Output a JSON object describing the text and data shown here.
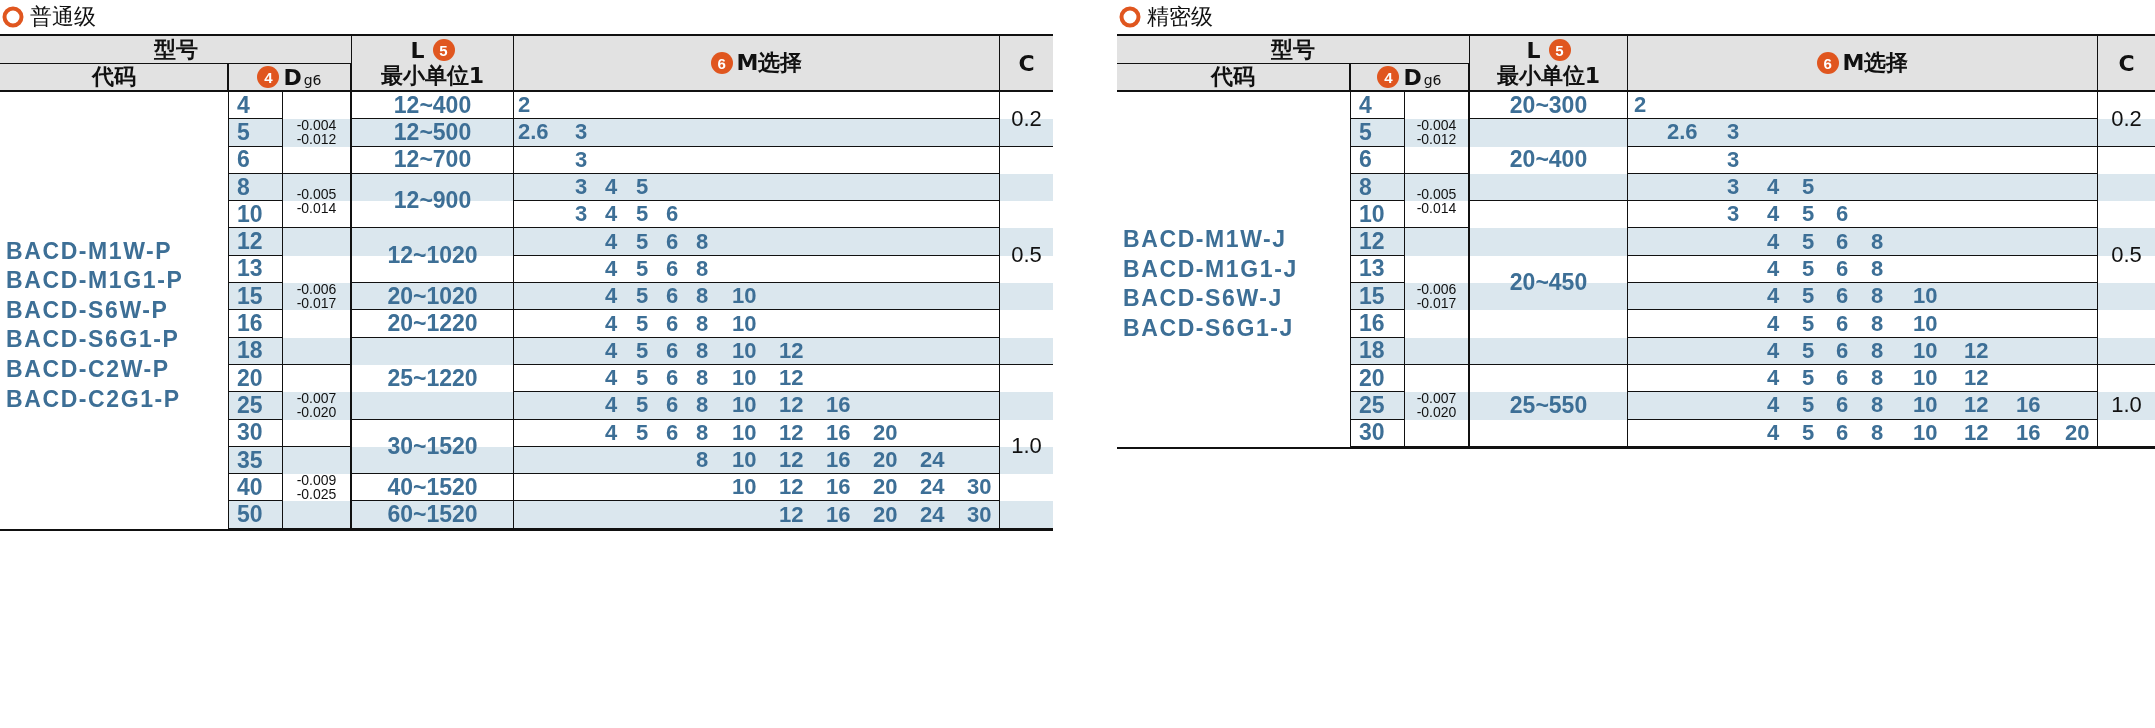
{
  "sections": [
    {
      "title": "普通级",
      "table": {
        "header": {
          "model": "型号",
          "code": "代码",
          "d_badge": "4",
          "d": "D$_{g6}$",
          "l": "L",
          "l_badge": "5",
          "l_note": "最小单位1",
          "m_badge": "6",
          "m": "M选择",
          "c": "C"
        },
        "codes": [
          "BACD-M1W-P",
          "BACD-M1G1-P",
          "BACD-S6W-P",
          "BACD-S6G1-P",
          "BACD-C2W-P",
          "BACD-C2G1-P"
        ],
        "rows": [
          {
            "d": "4",
            "tolerance": {
              "upper": "-0.004",
              "lower": "-0.012"
            },
            "length": "12~400",
            "m": [
              {
                "kind": "number",
                "text": "2"
              }
            ],
            "chamfer": "0.2"
          },
          {
            "d": "5",
            "length": "12~500",
            "m": [
              {
                "kind": "number",
                "text": "2.6"
              },
              {
                "kind": "number",
                "text": "3"
              }
            ]
          },
          {
            "d": "6",
            "length": "12~700",
            "m": [
              {
                "kind": "blank"
              },
              {
                "kind": "number",
                "text": "3"
              }
            ],
            "chamfer": "0.5"
          },
          {
            "d": "8",
            "tolerance": {
              "upper": "-0.005",
              "lower": "-0.014"
            },
            "length": "12~900",
            "m": [
              {
                "kind": "blank"
              },
              {
                "kind": "number",
                "text": "3"
              },
              {
                "kind": "number",
                "text": "4"
              },
              {
                "kind": "number",
                "text": "5"
              }
            ]
          },
          {
            "d": "10",
            "m": [
              {
                "kind": "blank"
              },
              {
                "kind": "number",
                "text": "3"
              },
              {
                "kind": "number",
                "text": "4"
              },
              {
                "kind": "number",
                "text": "5"
              },
              {
                "kind": "number",
                "text": "6"
              }
            ]
          },
          {
            "d": "12",
            "tolerance": {
              "upper": "-0.006",
              "lower": "-0.017"
            },
            "length": "12~1020",
            "m": [
              {
                "kind": "blank"
              },
              {
                "kind": "blank"
              },
              {
                "kind": "number",
                "text": "4"
              },
              {
                "kind": "number",
                "text": "5"
              },
              {
                "kind": "number",
                "text": "6"
              },
              {
                "kind": "number",
                "text": "8"
              }
            ]
          },
          {
            "d": "13",
            "m": [
              {
                "kind": "blank"
              },
              {
                "kind": "blank"
              },
              {
                "kind": "number",
                "text": "4"
              },
              {
                "kind": "number",
                "text": "5"
              },
              {
                "kind": "number",
                "text": "6"
              },
              {
                "kind": "number",
                "text": "8"
              }
            ]
          },
          {
            "d": "15",
            "length": "20~1020",
            "m": [
              {
                "kind": "blank"
              },
              {
                "kind": "blank"
              },
              {
                "kind": "number",
                "text": "4"
              },
              {
                "kind": "number",
                "text": "5"
              },
              {
                "kind": "number",
                "text": "6"
              },
              {
                "kind": "number",
                "text": "8"
              },
              {
                "kind": "number",
                "text": "10"
              }
            ]
          },
          {
            "d": "16",
            "length": "20~1220",
            "m": [
              {
                "kind": "blank"
              },
              {
                "kind": "blank"
              },
              {
                "kind": "number",
                "text": "4"
              },
              {
                "kind": "number",
                "text": "5"
              },
              {
                "kind": "number",
                "text": "6"
              },
              {
                "kind": "number",
                "text": "8"
              },
              {
                "kind": "number",
                "text": "10"
              }
            ]
          },
          {
            "d": "18",
            "length": "25~1220",
            "m": [
              {
                "kind": "blank"
              },
              {
                "kind": "blank"
              },
              {
                "kind": "number",
                "text": "4"
              },
              {
                "kind": "number",
                "text": "5"
              },
              {
                "kind": "number",
                "text": "6"
              },
              {
                "kind": "number",
                "text": "8"
              },
              {
                "kind": "number",
                "text": "10"
              },
              {
                "kind": "number",
                "text": "12"
              }
            ]
          },
          {
            "d": "20",
            "tolerance": {
              "upper": "-0.007",
              "lower": "-0.020"
            },
            "m": [
              {
                "kind": "blank"
              },
              {
                "kind": "blank"
              },
              {
                "kind": "number",
                "text": "4"
              },
              {
                "kind": "number",
                "text": "5"
              },
              {
                "kind": "number",
                "text": "6"
              },
              {
                "kind": "number",
                "text": "8"
              },
              {
                "kind": "number",
                "text": "10"
              },
              {
                "kind": "number",
                "text": "12"
              }
            ],
            "chamfer": "1.0"
          },
          {
            "d": "25",
            "m": [
              {
                "kind": "blank"
              },
              {
                "kind": "blank"
              },
              {
                "kind": "number",
                "text": "4"
              },
              {
                "kind": "number",
                "text": "5"
              },
              {
                "kind": "number",
                "text": "6"
              },
              {
                "kind": "number",
                "text": "8"
              },
              {
                "kind": "number",
                "text": "10"
              },
              {
                "kind": "number",
                "text": "12"
              },
              {
                "kind": "number",
                "text": "16"
              }
            ]
          },
          {
            "d": "30",
            "length": "30~1520",
            "m": [
              {
                "kind": "blank"
              },
              {
                "kind": "blank"
              },
              {
                "kind": "number",
                "text": "4"
              },
              {
                "kind": "number",
                "text": "5"
              },
              {
                "kind": "number",
                "text": "6"
              },
              {
                "kind": "number",
                "text": "8"
              },
              {
                "kind": "number",
                "text": "10"
              },
              {
                "kind": "number",
                "text": "12"
              },
              {
                "kind": "number",
                "text": "16"
              },
              {
                "kind": "number",
                "text": "20"
              }
            ]
          },
          {
            "d": "35",
            "tolerance": {
              "upper": "-0.009",
              "lower": "-0.025"
            },
            "m": [
              {
                "kind": "blank"
              },
              {
                "kind": "blank"
              },
              {
                "kind": "blank"
              },
              {
                "kind": "blank"
              },
              {
                "kind": "blank"
              },
              {
                "kind": "number",
                "text": "8"
              },
              {
                "kind": "number",
                "text": "10"
              },
              {
                "kind": "number",
                "text": "12"
              },
              {
                "kind": "number",
                "text": "16"
              },
              {
                "kind": "number",
                "text": "20"
              },
              {
                "kind": "number",
                "text": "24"
              }
            ]
          },
          {
            "d": "40",
            "length": "40~1520",
            "m": [
              {
                "kind": "blank"
              },
              {
                "kind": "blank"
              },
              {
                "kind": "blank"
              },
              {
                "kind": "blank"
              },
              {
                "kind": "blank"
              },
              {
                "kind": "blank"
              },
              {
                "kind": "number",
                "text": "10"
              },
              {
                "kind": "number",
                "text": "12"
              },
              {
                "kind": "number",
                "text": "16"
              },
              {
                "kind": "number",
                "text": "20"
              },
              {
                "kind": "number",
                "text": "24"
              },
              {
                "kind": "number",
                "text": "30"
              }
            ]
          },
          {
            "d": "50",
            "length": "60~1520",
            "m": [
              {
                "kind": "blank"
              },
              {
                "kind": "blank"
              },
              {
                "kind": "blank"
              },
              {
                "kind": "blank"
              },
              {
                "kind": "blank"
              },
              {
                "kind": "blank"
              },
              {
                "kind": "blank"
              },
              {
                "kind": "number",
                "text": "12"
              },
              {
                "kind": "number",
                "text": "16"
              },
              {
                "kind": "number",
                "text": "20"
              },
              {
                "kind": "number",
                "text": "24"
              },
              {
                "kind": "number",
                "text": "30"
              }
            ]
          }
        ]
      }
    },
    {
      "title": "精密级",
      "table": {
        "header": {
          "model": "型号",
          "code": "代码",
          "d_badge": "4",
          "d": "D$_{g6}$",
          "l": "L",
          "l_badge": "5",
          "l_note": "最小单位1",
          "m_badge": "6",
          "m": "M选择",
          "c": "C"
        },
        "codes": [
          "BACD-M1W-J",
          "BACD-M1G1-J",
          "BACD-S6W-J",
          "BACD-S6G1-J"
        ],
        "rows": [
          {
            "d": "4",
            "tolerance": {
              "upper": "-0.004",
              "lower": "-0.012"
            },
            "length": "20~300",
            "m": [
              {
                "kind": "number",
                "text": "2"
              }
            ],
            "chamfer": "0.2"
          },
          {
            "d": "5",
            "length": "20~400",
            "m": [
              {
                "kind": "blank"
              },
              {
                "kind": "number",
                "text": "2.6"
              },
              {
                "kind": "number",
                "text": "3"
              }
            ]
          },
          {
            "d": "6",
            "m": [
              {
                "kind": "blank"
              },
              {
                "kind": "blank"
              },
              {
                "kind": "number",
                "text": "3"
              }
            ],
            "chamfer": "0.5"
          },
          {
            "d": "8",
            "tolerance": {
              "upper": "-0.005",
              "lower": "-0.014"
            },
            "m": [
              {
                "kind": "blank"
              },
              {
                "kind": "blank"
              },
              {
                "kind": "number",
                "text": "3"
              },
              {
                "kind": "number",
                "text": "4"
              },
              {
                "kind": "number",
                "text": "5"
              }
            ]
          },
          {
            "d": "10",
            "length": "20~450",
            "m": [
              {
                "kind": "blank"
              },
              {
                "kind": "blank"
              },
              {
                "kind": "number",
                "text": "3"
              },
              {
                "kind": "number",
                "text": "4"
              },
              {
                "kind": "number",
                "text": "5"
              },
              {
                "kind": "number",
                "text": "6"
              }
            ]
          },
          {
            "d": "12",
            "tolerance": {
              "upper": "-0.006",
              "lower": "-0.017"
            },
            "m": [
              {
                "kind": "blank"
              },
              {
                "kind": "blank"
              },
              {
                "kind": "blank"
              },
              {
                "kind": "number",
                "text": "4"
              },
              {
                "kind": "number",
                "text": "5"
              },
              {
                "kind": "number",
                "text": "6"
              },
              {
                "kind": "number",
                "text": "8"
              }
            ]
          },
          {
            "d": "13",
            "m": [
              {
                "kind": "blank"
              },
              {
                "kind": "blank"
              },
              {
                "kind": "blank"
              },
              {
                "kind": "number",
                "text": "4"
              },
              {
                "kind": "number",
                "text": "5"
              },
              {
                "kind": "number",
                "text": "6"
              },
              {
                "kind": "number",
                "text": "8"
              }
            ]
          },
          {
            "d": "15",
            "m": [
              {
                "kind": "blank"
              },
              {
                "kind": "blank"
              },
              {
                "kind": "blank"
              },
              {
                "kind": "number",
                "text": "4"
              },
              {
                "kind": "number",
                "text": "5"
              },
              {
                "kind": "number",
                "text": "6"
              },
              {
                "kind": "number",
                "text": "8"
              },
              {
                "kind": "number",
                "text": "10"
              }
            ]
          },
          {
            "d": "16",
            "m": [
              {
                "kind": "blank"
              },
              {
                "kind": "blank"
              },
              {
                "kind": "blank"
              },
              {
                "kind": "number",
                "text": "4"
              },
              {
                "kind": "number",
                "text": "5"
              },
              {
                "kind": "number",
                "text": "6"
              },
              {
                "kind": "number",
                "text": "8"
              },
              {
                "kind": "number",
                "text": "10"
              }
            ]
          },
          {
            "d": "18",
            "m": [
              {
                "kind": "blank"
              },
              {
                "kind": "blank"
              },
              {
                "kind": "blank"
              },
              {
                "kind": "number",
                "text": "4"
              },
              {
                "kind": "number",
                "text": "5"
              },
              {
                "kind": "number",
                "text": "6"
              },
              {
                "kind": "number",
                "text": "8"
              },
              {
                "kind": "number",
                "text": "10"
              },
              {
                "kind": "number",
                "text": "12"
              }
            ]
          },
          {
            "d": "20",
            "tolerance": {
              "upper": "-0.007",
              "lower": "-0.020"
            },
            "length": "25~550",
            "m": [
              {
                "kind": "blank"
              },
              {
                "kind": "blank"
              },
              {
                "kind": "blank"
              },
              {
                "kind": "number",
                "text": "4"
              },
              {
                "kind": "number",
                "text": "5"
              },
              {
                "kind": "number",
                "text": "6"
              },
              {
                "kind": "number",
                "text": "8"
              },
              {
                "kind": "number",
                "text": "10"
              },
              {
                "kind": "number",
                "text": "12"
              }
            ],
            "chamfer": "1.0"
          },
          {
            "d": "25",
            "m": [
              {
                "kind": "blank"
              },
              {
                "kind": "blank"
              },
              {
                "kind": "blank"
              },
              {
                "kind": "number",
                "text": "4"
              },
              {
                "kind": "number",
                "text": "5"
              },
              {
                "kind": "number",
                "text": "6"
              },
              {
                "kind": "number",
                "text": "8"
              },
              {
                "kind": "number",
                "text": "10"
              },
              {
                "kind": "number",
                "text": "12"
              },
              {
                "kind": "number",
                "text": "16"
              }
            ]
          },
          {
            "d": "30",
            "m": [
              {
                "kind": "blank"
              },
              {
                "kind": "blank"
              },
              {
                "kind": "blank"
              },
              {
                "kind": "number",
                "text": "4"
              },
              {
                "kind": "number",
                "text": "5"
              },
              {
                "kind": "number",
                "text": "6"
              },
              {
                "kind": "number",
                "text": "8"
              },
              {
                "kind": "number",
                "text": "10"
              },
              {
                "kind": "number",
                "text": "12"
              },
              {
                "kind": "number",
                "text": "16"
              },
              {
                "kind": "number",
                "text": "20"
              }
            ]
          }
        ]
      }
    }
  ]
}
